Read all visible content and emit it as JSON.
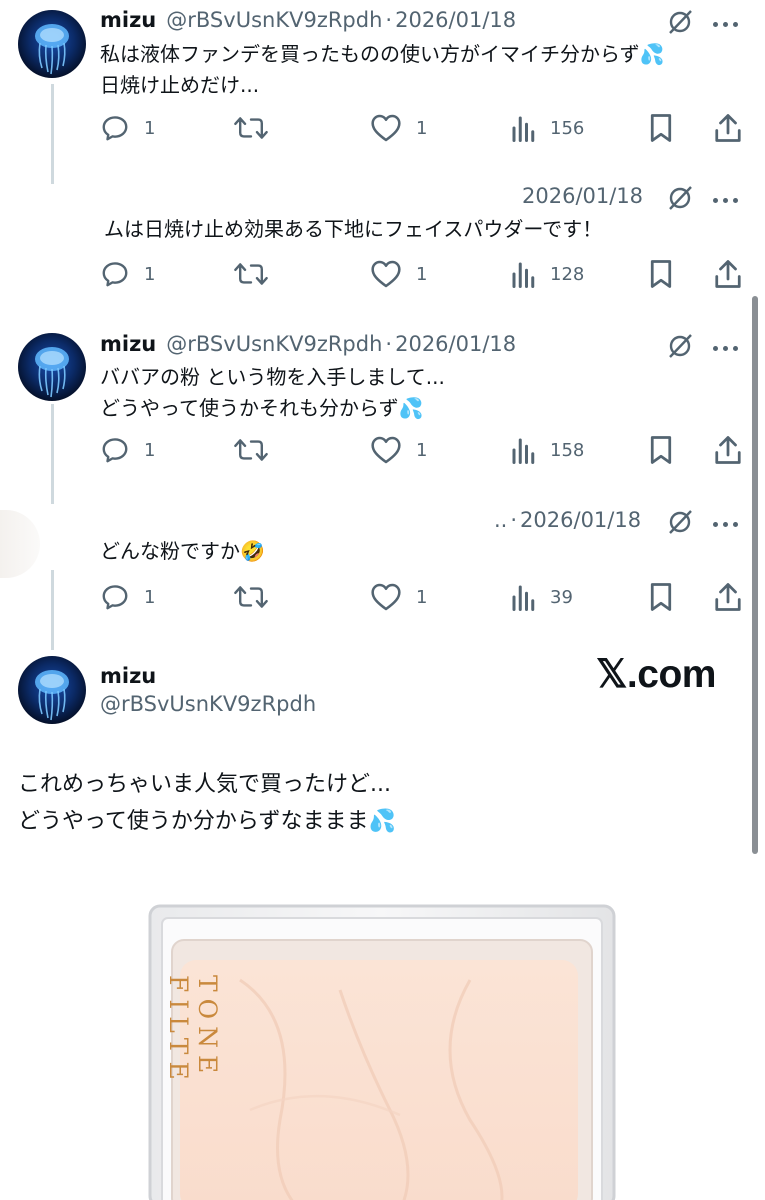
{
  "tweets": [
    {
      "name": "mizu",
      "handle": "@rBSvUsnKV9zRpdh",
      "date": "2026/01/18",
      "text": "私は液体ファンデを買ったものの使い方がイマイチ分からず💦\n日焼け止めだけ...",
      "replies": "1",
      "likes": "1",
      "views": "156"
    },
    {
      "name": "",
      "handle": "",
      "date": "2026/01/18",
      "text": "ムは日焼け止め効果ある下地にフェイスパウダーです！",
      "replies": "1",
      "likes": "1",
      "views": "128"
    },
    {
      "name": "mizu",
      "handle": "@rBSvUsnKV9zRpdh",
      "date": "2026/01/18",
      "text": "ババアの粉 という物を入手しまして...\nどうやって使うかそれも分からず💦",
      "replies": "1",
      "likes": "1",
      "views": "158"
    },
    {
      "name": "",
      "handle": "..",
      "date": "2026/01/18",
      "text": "どんな粉ですか🤣",
      "replies": "1",
      "likes": "1",
      "views": "39"
    }
  ],
  "main_post": {
    "name": "mizu",
    "handle": "@rBSvUsnKV9zRpdh",
    "text": "これめっちゃいま人気で買ったけど...\nどうやって使うか分からずなままま💦",
    "watermark": "𝕏.com",
    "product_lettering": "TONE FILTE"
  },
  "icons": [
    "reply-icon",
    "retweet-icon",
    "like-icon",
    "views-icon",
    "bookmark-icon",
    "share-icon",
    "grok-icon",
    "more-icon"
  ],
  "colors": {
    "text": "#0f1419",
    "muted": "#536471",
    "thread_line": "#cfd9de",
    "product_text": "#c9893d"
  }
}
